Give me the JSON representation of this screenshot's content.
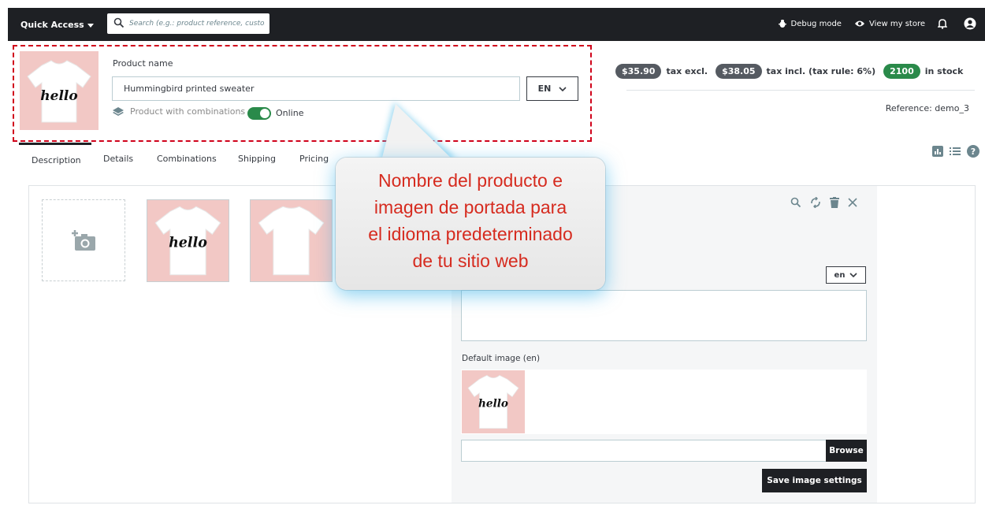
{
  "topbar": {
    "quick_access": "Quick Access",
    "search_placeholder": "Search (e.g.: product reference, custon",
    "debug_mode": "Debug mode",
    "view_store": "View my store"
  },
  "product": {
    "name_label": "Product name",
    "name_value": "Hummingbird printed sweater",
    "language": "EN",
    "combinations_label": "Product with combinations",
    "online_label": "Online",
    "online": true,
    "image_text": "hello"
  },
  "pricing": {
    "tax_excl_price": "$35.90",
    "tax_excl_label": "tax excl.",
    "tax_incl_price": "$38.05",
    "tax_incl_label": "tax incl. (tax rule: 6%)",
    "stock_count": "2100",
    "stock_label": "in stock",
    "reference": "Reference: demo_3"
  },
  "tabs": [
    {
      "label": "Description",
      "active": true
    },
    {
      "label": "Details",
      "active": false
    },
    {
      "label": "Combinations",
      "active": false
    },
    {
      "label": "Shipping",
      "active": false
    },
    {
      "label": "Pricing",
      "active": false
    }
  ],
  "image_settings": {
    "language": "en",
    "default_image_label": "Default image (en)",
    "browse_label": "Browse",
    "save_label": "Save image settings"
  },
  "callout": {
    "lines": [
      "Nombre del producto e",
      "imagen de portada para",
      "el idioma predeterminado",
      "de tu sitio web"
    ]
  },
  "colors": {
    "topbar": "#1e2024",
    "callout_text": "#d62b1f",
    "highlight_border": "#d0021b",
    "online_toggle": "#2a8a4a",
    "product_bg": "#f2c8c5"
  }
}
